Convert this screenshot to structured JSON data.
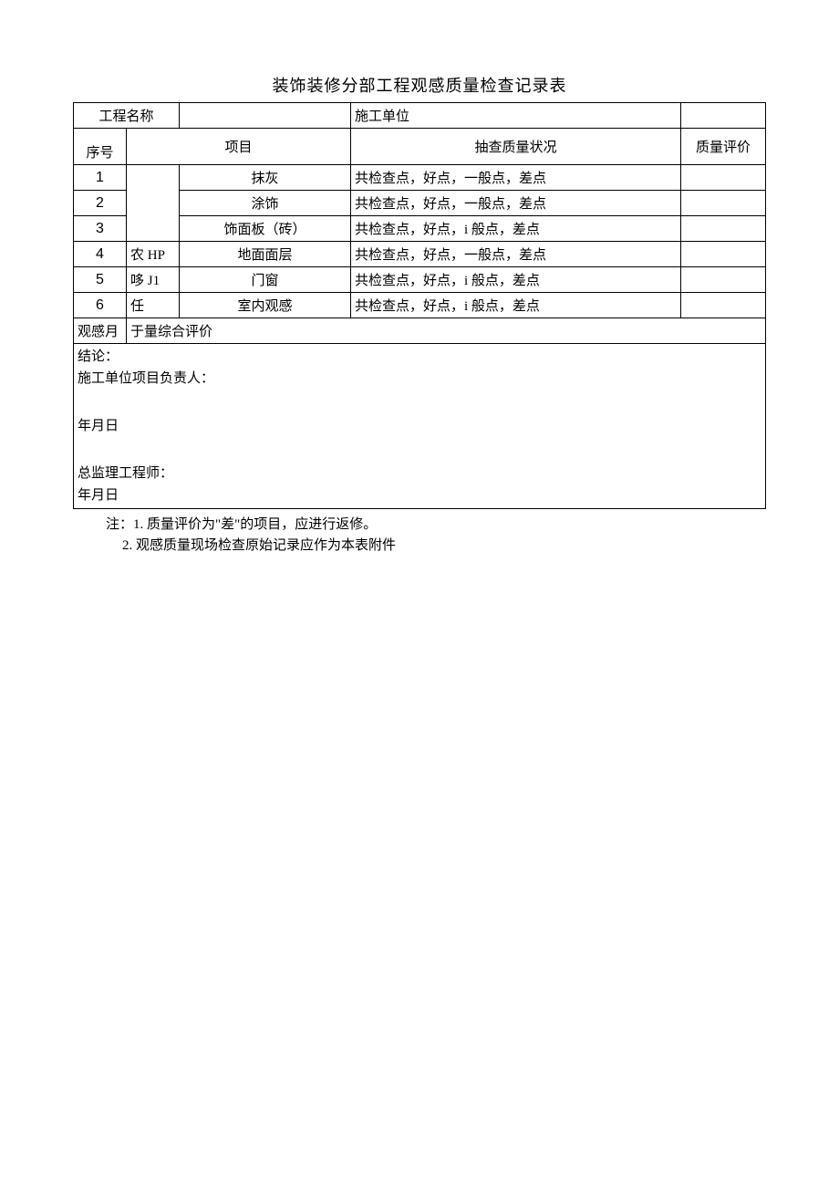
{
  "title": "装饰装修分部工程观感质量检查记录表",
  "header": {
    "project_name_label": "工程名称",
    "project_name_value": "",
    "construction_unit_label": "施工单位",
    "construction_unit_value": ""
  },
  "columns": {
    "seq": "序号",
    "item": "项目",
    "status": "抽查质量状况",
    "eval": "质量评价"
  },
  "rows": [
    {
      "seq": "1",
      "cat": "",
      "item": "抹灰",
      "status": "共检查点，好点，一般点，差点",
      "eval": ""
    },
    {
      "seq": "2",
      "cat": "",
      "item": "涂饰",
      "status": "共检查点，好点，一般点，差点",
      "eval": ""
    },
    {
      "seq": "3",
      "cat": "",
      "item": "饰面板（砖）",
      "status": "共检查点，好点，i 般点，差点",
      "eval": ""
    },
    {
      "seq": "4",
      "cat": "农 HP",
      "item": "地面面层",
      "status": "共检查点，好点，一般点，差点",
      "eval": ""
    },
    {
      "seq": "5",
      "cat": "哆 J1",
      "item": "门窗",
      "status": "共检查点，好点，i 般点，差点",
      "eval": ""
    },
    {
      "seq": "6",
      "cat": "任",
      "item": "室内观感",
      "status": "共检查点，好点，i 般点，差点",
      "eval": ""
    }
  ],
  "summary_row": {
    "left": "观感月",
    "right": "于量综合评价"
  },
  "conclusion": {
    "label": "结论：",
    "line_project_manager": "施工单位项目负责人：",
    "line_date1": "年月日",
    "line_supervisor": "总监理工程师：",
    "line_date2": "年月日"
  },
  "notes": {
    "line1": "注：1. 质量评价为\"差\"的项目，应进行返修。",
    "line2": "2. 观感质量现场检查原始记录应作为本表附件"
  }
}
